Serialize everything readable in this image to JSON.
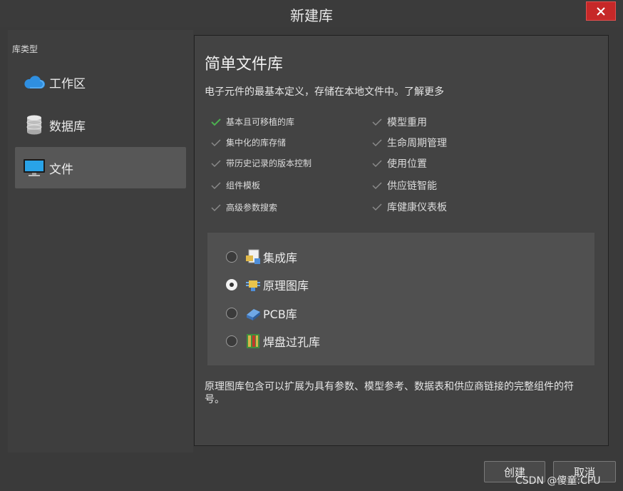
{
  "window": {
    "title": "新建库"
  },
  "sidebar": {
    "section_label": "库类型",
    "items": [
      {
        "label": "工作区",
        "icon": "cloud-icon"
      },
      {
        "label": "数据库",
        "icon": "database-icon"
      },
      {
        "label": "文件",
        "icon": "monitor-icon",
        "selected": true
      }
    ]
  },
  "main": {
    "heading": "简单文件库",
    "description": "电子元件的最基本定义，存储在本地文件中。了解更多",
    "features_left": [
      "基本且可移植的库",
      "集中化的库存储",
      "带历史记录的版本控制",
      "组件模板",
      "高级参数搜索"
    ],
    "features_right": [
      "模型重用",
      "生命周期管理",
      "使用位置",
      "供应链智能",
      "库健康仪表板"
    ],
    "options": [
      {
        "label": "集成库",
        "selected": false
      },
      {
        "label": "原理图库",
        "selected": true
      },
      {
        "label": "PCB库",
        "selected": false
      },
      {
        "label": "焊盘过孔库",
        "selected": false
      }
    ],
    "footer": "原理图库包含可以扩展为具有参数、模型参考、数据表和供应商链接的完整组件的符号。"
  },
  "buttons": {
    "create": "创建",
    "cancel": "取消"
  },
  "watermark": "CSDN @傻童:CPU",
  "colors": {
    "check_active": "#4caf50",
    "check_inactive": "#8a8a8a",
    "close": "#c62828"
  }
}
